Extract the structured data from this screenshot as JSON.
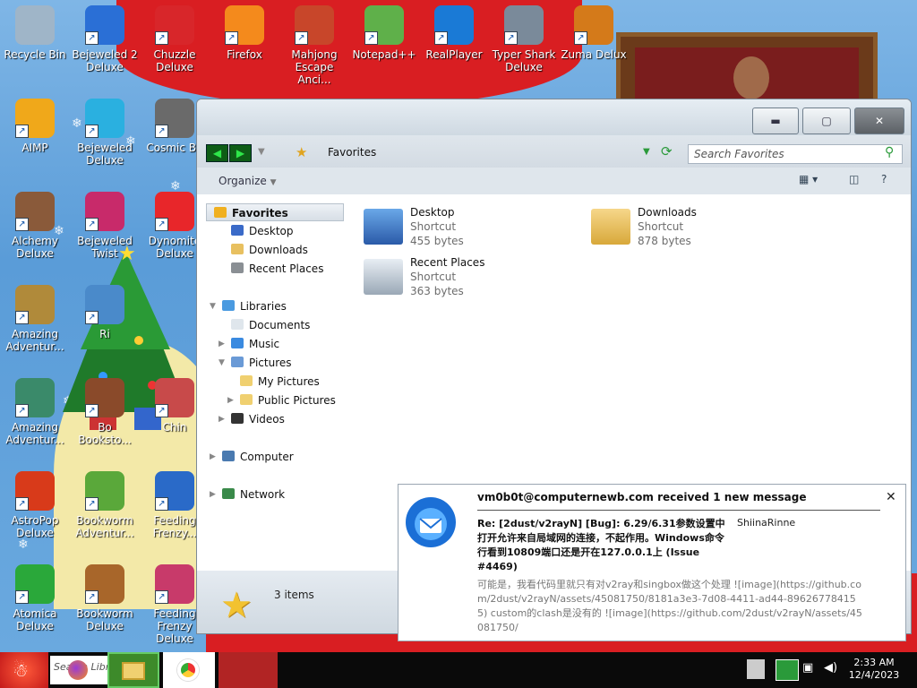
{
  "desktop_icons": [
    {
      "label": "Recycle Bin",
      "icon": "recycle-bin-icon",
      "color": "#9fb5c8"
    },
    {
      "label": "Bejeweled 2 Deluxe",
      "icon": "bejeweled2-icon",
      "color": "#2a6fd6"
    },
    {
      "label": "Chuzzle Deluxe",
      "icon": "chuzzle-icon",
      "color": "#d8262a"
    },
    {
      "label": "Firefox",
      "icon": "firefox-icon",
      "color": "#f48a1c"
    },
    {
      "label": "Mahjong Escape Anci...",
      "icon": "mahjong-icon",
      "color": "#c8462a"
    },
    {
      "label": "Notepad++",
      "icon": "notepadpp-icon",
      "color": "#5fb04a"
    },
    {
      "label": "RealPlayer",
      "icon": "realplayer-icon",
      "color": "#1a7ad6"
    },
    {
      "label": "Typer Shark Deluxe",
      "icon": "typer-shark-icon",
      "color": "#7a8a9a"
    },
    {
      "label": "Zuma Delux",
      "icon": "zuma-icon",
      "color": "#d47a1a"
    },
    {
      "label": "AIMP",
      "icon": "aimp-icon",
      "color": "#f0a81a"
    },
    {
      "label": "Bejeweled Deluxe",
      "icon": "bejeweled-icon",
      "color": "#2ab0e0"
    },
    {
      "label": "Cosmic Bu",
      "icon": "cosmic-bugs-icon",
      "color": "#6a6a6a"
    },
    {
      "label": "Alchemy Deluxe",
      "icon": "alchemy-icon",
      "color": "#8a5a3a"
    },
    {
      "label": "Bejeweled Twist",
      "icon": "bejeweled-twist-icon",
      "color": "#c82a6a"
    },
    {
      "label": "Dynomite Deluxe",
      "icon": "dynomite-icon",
      "color": "#e8262a"
    },
    {
      "label": "Amazing Adventur...",
      "icon": "amazing-adventures-icon",
      "color": "#b08a3a"
    },
    {
      "label": "Ri",
      "icon": "ri-icon",
      "color": "#4a8aca"
    },
    {
      "label": "Amazing Adventur...",
      "icon": "amazing-adventures2-icon",
      "color": "#3a8a6a"
    },
    {
      "label": "Bo Booksto...",
      "icon": "bookstore-icon",
      "color": "#8a4a2a"
    },
    {
      "label": "Chin",
      "icon": "chin-icon",
      "color": "#c84a4a"
    },
    {
      "label": "AstroPop Deluxe",
      "icon": "astropop-icon",
      "color": "#d83a1a"
    },
    {
      "label": "Bookworm Adventur...",
      "icon": "bookworm-adventures-icon",
      "color": "#5aa83a"
    },
    {
      "label": "Feeding Frenzy...",
      "icon": "feeding-frenzy-icon",
      "color": "#2a6ac8"
    },
    {
      "label": "Atomica Deluxe",
      "icon": "atomica-icon",
      "color": "#2aa83a"
    },
    {
      "label": "Bookworm Deluxe",
      "icon": "bookworm-icon",
      "color": "#a8662a"
    },
    {
      "label": "Feeding Frenzy Deluxe",
      "icon": "feeding-frenzy2-icon",
      "color": "#c83a6a"
    }
  ],
  "explorer": {
    "location": "Favorites",
    "search_placeholder": "Search Favorites",
    "organize": "Organize",
    "status": "3 items",
    "nav": [
      {
        "label": "Favorites",
        "bold": true
      },
      {
        "label": "Desktop"
      },
      {
        "label": "Downloads"
      },
      {
        "label": "Recent Places"
      },
      {
        "label": "Libraries"
      },
      {
        "label": "Documents"
      },
      {
        "label": "Music"
      },
      {
        "label": "Pictures"
      },
      {
        "label": "My Pictures"
      },
      {
        "label": "Public Pictures"
      },
      {
        "label": "Videos"
      },
      {
        "label": "Computer"
      },
      {
        "label": "Network"
      }
    ],
    "files": [
      {
        "name": "Desktop",
        "type": "Shortcut",
        "size": "455 bytes"
      },
      {
        "name": "Downloads",
        "type": "Shortcut",
        "size": "878 bytes"
      },
      {
        "name": "Recent Places",
        "type": "Shortcut",
        "size": "363 bytes"
      }
    ]
  },
  "notification": {
    "title": "vm0b0t@computernewb.com received 1 new message",
    "subject": "Re: [2dust/v2rayN] [Bug]: 6.29/6.31参数设置中打开允许来自局域网的连接，不起作用。Windows命令行看到10809端口还是开在127.0.0.1上 (Issue #4469)",
    "sender": "ShiinaRinne",
    "preview": "可能是，我看代码里就只有对v2ray和singbox做这个处理 ![image](https://github.com/2dust/v2rayN/assets/45081750/8181a3e3-7d08-4411-ad44-896267784155) custom的clash是没有的 ![image](https://github.com/2dust/v2rayN/assets/45081750/"
  },
  "taskbar": {
    "search_text": "Search Libr",
    "time": "2:33 AM",
    "date": "12/4/2023"
  }
}
